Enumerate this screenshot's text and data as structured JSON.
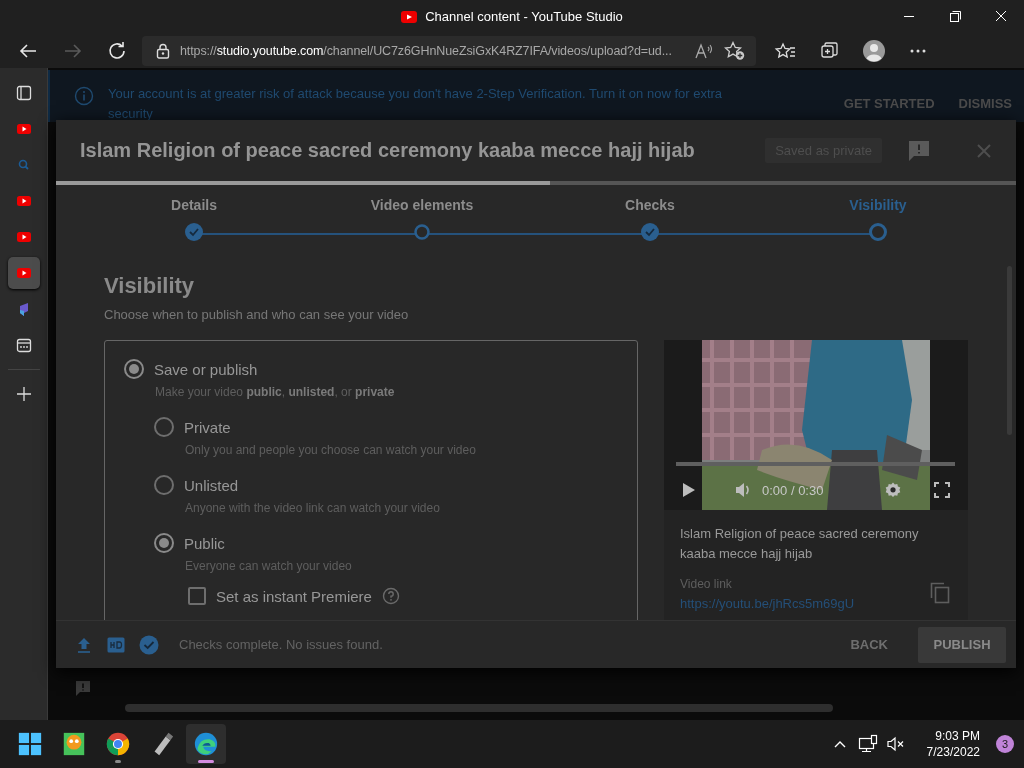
{
  "window": {
    "title": "Channel content - YouTube Studio"
  },
  "browser": {
    "nav": [
      {
        "kind": "back",
        "disabled": false
      },
      {
        "kind": "forward",
        "disabled": true
      },
      {
        "kind": "reload",
        "disabled": false
      }
    ],
    "url": "https://**studio.youtube.com**/channel/UC7z6GHnNueZsiGxK4RZ7IFA/videos/upload?d=ud..."
  },
  "sidebar": {
    "items": [
      {
        "kind": "tabs",
        "selected": false
      },
      {
        "kind": "youtube",
        "selected": false
      },
      {
        "kind": "search",
        "selected": false
      },
      {
        "kind": "youtube",
        "selected": false
      },
      {
        "kind": "youtube",
        "selected": false
      },
      {
        "kind": "youtube",
        "selected": true
      },
      {
        "kind": "app",
        "selected": false
      },
      {
        "kind": "capture",
        "selected": false
      },
      {
        "kind": "add",
        "selected": false
      }
    ]
  },
  "banner": {
    "message": "Your account is at greater risk of attack because you don't have 2-Step Verification. Turn it on now for extra security",
    "actions": [
      "GET STARTED",
      "DISMISS"
    ]
  },
  "dialog": {
    "title": "Islam Religion of peace sacred ceremony kaaba mecce hajj hijab",
    "saved_status": "Saved as private",
    "progress": {
      "level": 0.515
    },
    "steps": [
      {
        "label": "Details",
        "done": true,
        "selected": false
      },
      {
        "label": "Video elements",
        "done": false,
        "selected": false
      },
      {
        "label": "Checks",
        "done": true,
        "selected": false
      },
      {
        "label": "Visibility",
        "done": false,
        "selected": true
      }
    ],
    "visibility": {
      "heading": "Visibility",
      "subtitle": "Choose when to publish and who can see your video",
      "save_option": {
        "label": "Save or publish",
        "description": "Make your video **public**, **unlisted**, or **private**",
        "selected": true
      },
      "options": [
        {
          "label": "Private",
          "description": "Only you and people you choose can watch your video",
          "selected": false
        },
        {
          "label": "Unlisted",
          "description": "Anyone with the video link can watch your video",
          "selected": false
        },
        {
          "label": "Public",
          "description": "Everyone can watch your video",
          "selected": true
        }
      ],
      "premiere": {
        "label": "Set as instant Premiere",
        "checked": false
      }
    },
    "preview": {
      "playback": {
        "level": 0
      },
      "time": "0:00 / 0:30",
      "video_title": "Islam Religion of peace sacred ceremony kaaba mecce hajj hijab",
      "link_label": "Video link",
      "link": "https://youtu.be/jhRcs5m69gU"
    },
    "footer": {
      "status": "Checks complete. No issues found.",
      "back": "BACK",
      "publish": "PUBLISH"
    }
  },
  "taskbar": {
    "apps": [
      {
        "kind": "start",
        "selected": false,
        "running": false
      },
      {
        "kind": "app",
        "selected": false,
        "running": false
      },
      {
        "kind": "chrome",
        "selected": false,
        "running": true
      },
      {
        "kind": "usb",
        "selected": false,
        "running": false
      },
      {
        "kind": "edge",
        "selected": true,
        "running": true
      }
    ],
    "time": "9:03 PM",
    "date": "7/23/2022",
    "notifications": "3"
  }
}
